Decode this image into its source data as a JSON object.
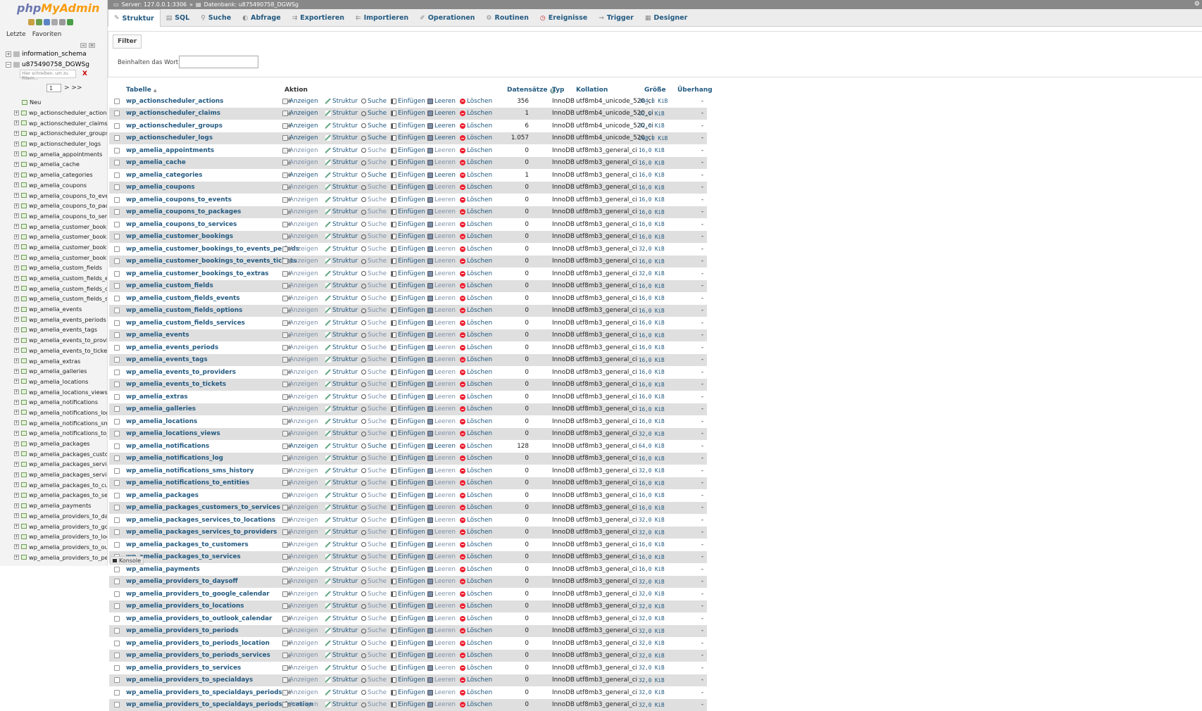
{
  "app": {
    "logo_php": "php",
    "logo_ma": "MyAdmin",
    "sidebar_tabs": [
      "Letzte",
      "Favoriten"
    ],
    "databases": [
      "information_schema",
      "u875490758_DGWSg"
    ],
    "filter_placeholder": "Hier schreiben, um zu filtern...",
    "filter_clear": "X",
    "page_select": "1",
    "page_next": "> >>",
    "tree_new": "Neu"
  },
  "breadcrumb": {
    "server": "Server: 127.0.0.1:3306",
    "sep": "»",
    "database": "Datenbank: u875490758_DGWSg"
  },
  "tabs": [
    "Struktur",
    "SQL",
    "Suche",
    "Abfrage",
    "Exportieren",
    "Importieren",
    "Operationen",
    "Routinen",
    "Ereignisse",
    "Trigger",
    "Designer"
  ],
  "filter": {
    "legend": "Filter",
    "label": "Beinhalten das Wort:",
    "value": ""
  },
  "columns": {
    "table": "Tabelle",
    "sort_arrow": "▲",
    "action": "Aktion",
    "rows": "Datensätze",
    "type": "Typ",
    "collation": "Kollation",
    "size": "Größe",
    "overhead": "Überhang"
  },
  "actions": {
    "browse": "Anzeigen",
    "structure": "Struktur",
    "search": "Suche",
    "insert": "Einfügen",
    "empty": "Leeren",
    "drop": "Löschen"
  },
  "console": "Konsole",
  "tree_items": [
    "wp_actionscheduler_actions",
    "wp_actionscheduler_claims",
    "wp_actionscheduler_groups",
    "wp_actionscheduler_logs",
    "wp_amelia_appointments",
    "wp_amelia_cache",
    "wp_amelia_categories",
    "wp_amelia_coupons",
    "wp_amelia_coupons_to_even",
    "wp_amelia_coupons_to_pack",
    "wp_amelia_coupons_to_servi",
    "wp_amelia_customer_bookin",
    "wp_amelia_customer_bookin",
    "wp_amelia_customer_bookin",
    "wp_amelia_customer_bookin",
    "wp_amelia_custom_fields",
    "wp_amelia_custom_fields_ev",
    "wp_amelia_custom_fields_op",
    "wp_amelia_custom_fields_se",
    "wp_amelia_events",
    "wp_amelia_events_periods",
    "wp_amelia_events_tags",
    "wp_amelia_events_to_provid",
    "wp_amelia_events_to_tickets",
    "wp_amelia_extras",
    "wp_amelia_galleries",
    "wp_amelia_locations",
    "wp_amelia_locations_views",
    "wp_amelia_notifications",
    "wp_amelia_notifications_log",
    "wp_amelia_notifications_sms",
    "wp_amelia_notifications_to_e",
    "wp_amelia_packages",
    "wp_amelia_packages_custom",
    "wp_amelia_packages_service",
    "wp_amelia_packages_service",
    "wp_amelia_packages_to_cus",
    "wp_amelia_packages_to_ser",
    "wp_amelia_payments",
    "wp_amelia_providers_to_day",
    "wp_amelia_providers_to_goo",
    "wp_amelia_providers_to_loca",
    "wp_amelia_providers_to_outl",
    "wp_amelia_providers_to_peri"
  ],
  "tables": [
    {
      "name": "wp_actionscheduler_actions",
      "rows": "356",
      "type": "InnoDB",
      "collation": "utf8mb4_unicode_520_ci",
      "size": "384,0 KiB",
      "overhead": "-"
    },
    {
      "name": "wp_actionscheduler_claims",
      "rows": "1",
      "type": "InnoDB",
      "collation": "utf8mb4_unicode_520_ci",
      "size": "32,0 KiB",
      "overhead": "-"
    },
    {
      "name": "wp_actionscheduler_groups",
      "rows": "6",
      "type": "InnoDB",
      "collation": "utf8mb4_unicode_520_ci",
      "size": "32,0 KiB",
      "overhead": "-"
    },
    {
      "name": "wp_actionscheduler_logs",
      "rows": "1.057",
      "type": "InnoDB",
      "collation": "utf8mb4_unicode_520_ci",
      "size": "208,0 KiB",
      "overhead": "-"
    },
    {
      "name": "wp_amelia_appointments",
      "rows": "0",
      "type": "InnoDB",
      "collation": "utf8mb3_general_ci",
      "size": "16,0 KiB",
      "overhead": "-"
    },
    {
      "name": "wp_amelia_cache",
      "rows": "0",
      "type": "InnoDB",
      "collation": "utf8mb3_general_ci",
      "size": "16,0 KiB",
      "overhead": "-"
    },
    {
      "name": "wp_amelia_categories",
      "rows": "1",
      "type": "InnoDB",
      "collation": "utf8mb3_general_ci",
      "size": "16,0 KiB",
      "overhead": "-"
    },
    {
      "name": "wp_amelia_coupons",
      "rows": "0",
      "type": "InnoDB",
      "collation": "utf8mb3_general_ci",
      "size": "16,0 KiB",
      "overhead": "-"
    },
    {
      "name": "wp_amelia_coupons_to_events",
      "rows": "0",
      "type": "InnoDB",
      "collation": "utf8mb3_general_ci",
      "size": "16,0 KiB",
      "overhead": "-"
    },
    {
      "name": "wp_amelia_coupons_to_packages",
      "rows": "0",
      "type": "InnoDB",
      "collation": "utf8mb3_general_ci",
      "size": "16,0 KiB",
      "overhead": "-"
    },
    {
      "name": "wp_amelia_coupons_to_services",
      "rows": "0",
      "type": "InnoDB",
      "collation": "utf8mb3_general_ci",
      "size": "16,0 KiB",
      "overhead": "-"
    },
    {
      "name": "wp_amelia_customer_bookings",
      "rows": "0",
      "type": "InnoDB",
      "collation": "utf8mb3_general_ci",
      "size": "16,0 KiB",
      "overhead": "-"
    },
    {
      "name": "wp_amelia_customer_bookings_to_events_periods",
      "rows": "0",
      "type": "InnoDB",
      "collation": "utf8mb3_general_ci",
      "size": "32,0 KiB",
      "overhead": "-"
    },
    {
      "name": "wp_amelia_customer_bookings_to_events_tickets",
      "rows": "0",
      "type": "InnoDB",
      "collation": "utf8mb3_general_ci",
      "size": "16,0 KiB",
      "overhead": "-"
    },
    {
      "name": "wp_amelia_customer_bookings_to_extras",
      "rows": "0",
      "type": "InnoDB",
      "collation": "utf8mb3_general_ci",
      "size": "32,0 KiB",
      "overhead": "-"
    },
    {
      "name": "wp_amelia_custom_fields",
      "rows": "0",
      "type": "InnoDB",
      "collation": "utf8mb3_general_ci",
      "size": "16,0 KiB",
      "overhead": "-"
    },
    {
      "name": "wp_amelia_custom_fields_events",
      "rows": "0",
      "type": "InnoDB",
      "collation": "utf8mb3_general_ci",
      "size": "16,0 KiB",
      "overhead": "-"
    },
    {
      "name": "wp_amelia_custom_fields_options",
      "rows": "0",
      "type": "InnoDB",
      "collation": "utf8mb3_general_ci",
      "size": "16,0 KiB",
      "overhead": "-"
    },
    {
      "name": "wp_amelia_custom_fields_services",
      "rows": "0",
      "type": "InnoDB",
      "collation": "utf8mb3_general_ci",
      "size": "16,0 KiB",
      "overhead": "-"
    },
    {
      "name": "wp_amelia_events",
      "rows": "0",
      "type": "InnoDB",
      "collation": "utf8mb3_general_ci",
      "size": "16,0 KiB",
      "overhead": "-"
    },
    {
      "name": "wp_amelia_events_periods",
      "rows": "0",
      "type": "InnoDB",
      "collation": "utf8mb3_general_ci",
      "size": "16,0 KiB",
      "overhead": "-"
    },
    {
      "name": "wp_amelia_events_tags",
      "rows": "0",
      "type": "InnoDB",
      "collation": "utf8mb3_general_ci",
      "size": "16,0 KiB",
      "overhead": "-"
    },
    {
      "name": "wp_amelia_events_to_providers",
      "rows": "0",
      "type": "InnoDB",
      "collation": "utf8mb3_general_ci",
      "size": "16,0 KiB",
      "overhead": "-"
    },
    {
      "name": "wp_amelia_events_to_tickets",
      "rows": "0",
      "type": "InnoDB",
      "collation": "utf8mb3_general_ci",
      "size": "16,0 KiB",
      "overhead": "-"
    },
    {
      "name": "wp_amelia_extras",
      "rows": "0",
      "type": "InnoDB",
      "collation": "utf8mb3_general_ci",
      "size": "16,0 KiB",
      "overhead": "-"
    },
    {
      "name": "wp_amelia_galleries",
      "rows": "0",
      "type": "InnoDB",
      "collation": "utf8mb3_general_ci",
      "size": "16,0 KiB",
      "overhead": "-"
    },
    {
      "name": "wp_amelia_locations",
      "rows": "0",
      "type": "InnoDB",
      "collation": "utf8mb3_general_ci",
      "size": "16,0 KiB",
      "overhead": "-"
    },
    {
      "name": "wp_amelia_locations_views",
      "rows": "0",
      "type": "InnoDB",
      "collation": "utf8mb3_general_ci",
      "size": "32,0 KiB",
      "overhead": "-"
    },
    {
      "name": "wp_amelia_notifications",
      "rows": "128",
      "type": "InnoDB",
      "collation": "utf8mb3_general_ci",
      "size": "64,0 KiB",
      "overhead": "-"
    },
    {
      "name": "wp_amelia_notifications_log",
      "rows": "0",
      "type": "InnoDB",
      "collation": "utf8mb3_general_ci",
      "size": "16,0 KiB",
      "overhead": "-"
    },
    {
      "name": "wp_amelia_notifications_sms_history",
      "rows": "0",
      "type": "InnoDB",
      "collation": "utf8mb3_general_ci",
      "size": "32,0 KiB",
      "overhead": "-"
    },
    {
      "name": "wp_amelia_notifications_to_entities",
      "rows": "0",
      "type": "InnoDB",
      "collation": "utf8mb3_general_ci",
      "size": "16,0 KiB",
      "overhead": "-"
    },
    {
      "name": "wp_amelia_packages",
      "rows": "0",
      "type": "InnoDB",
      "collation": "utf8mb3_general_ci",
      "size": "16,0 KiB",
      "overhead": "-"
    },
    {
      "name": "wp_amelia_packages_customers_to_services",
      "rows": "0",
      "type": "InnoDB",
      "collation": "utf8mb3_general_ci",
      "size": "16,0 KiB",
      "overhead": "-"
    },
    {
      "name": "wp_amelia_packages_services_to_locations",
      "rows": "0",
      "type": "InnoDB",
      "collation": "utf8mb3_general_ci",
      "size": "32,0 KiB",
      "overhead": "-"
    },
    {
      "name": "wp_amelia_packages_services_to_providers",
      "rows": "0",
      "type": "InnoDB",
      "collation": "utf8mb3_general_ci",
      "size": "32,0 KiB",
      "overhead": "-"
    },
    {
      "name": "wp_amelia_packages_to_customers",
      "rows": "0",
      "type": "InnoDB",
      "collation": "utf8mb3_general_ci",
      "size": "16,0 KiB",
      "overhead": "-"
    },
    {
      "name": "wp_amelia_packages_to_services",
      "rows": "0",
      "type": "InnoDB",
      "collation": "utf8mb3_general_ci",
      "size": "16,0 KiB",
      "overhead": "-"
    },
    {
      "name": "wp_amelia_payments",
      "rows": "0",
      "type": "InnoDB",
      "collation": "utf8mb3_general_ci",
      "size": "16,0 KiB",
      "overhead": "-"
    },
    {
      "name": "wp_amelia_providers_to_daysoff",
      "rows": "0",
      "type": "InnoDB",
      "collation": "utf8mb3_general_ci",
      "size": "32,0 KiB",
      "overhead": "-"
    },
    {
      "name": "wp_amelia_providers_to_google_calendar",
      "rows": "0",
      "type": "InnoDB",
      "collation": "utf8mb3_general_ci",
      "size": "32,0 KiB",
      "overhead": "-"
    },
    {
      "name": "wp_amelia_providers_to_locations",
      "rows": "0",
      "type": "InnoDB",
      "collation": "utf8mb3_general_ci",
      "size": "32,0 KiB",
      "overhead": "-"
    },
    {
      "name": "wp_amelia_providers_to_outlook_calendar",
      "rows": "0",
      "type": "InnoDB",
      "collation": "utf8mb3_general_ci",
      "size": "32,0 KiB",
      "overhead": "-"
    },
    {
      "name": "wp_amelia_providers_to_periods",
      "rows": "0",
      "type": "InnoDB",
      "collation": "utf8mb3_general_ci",
      "size": "32,0 KiB",
      "overhead": "-"
    },
    {
      "name": "wp_amelia_providers_to_periods_location",
      "rows": "0",
      "type": "InnoDB",
      "collation": "utf8mb3_general_ci",
      "size": "32,0 KiB",
      "overhead": "-"
    },
    {
      "name": "wp_amelia_providers_to_periods_services",
      "rows": "0",
      "type": "InnoDB",
      "collation": "utf8mb3_general_ci",
      "size": "32,0 KiB",
      "overhead": "-"
    },
    {
      "name": "wp_amelia_providers_to_services",
      "rows": "0",
      "type": "InnoDB",
      "collation": "utf8mb3_general_ci",
      "size": "32,0 KiB",
      "overhead": "-"
    },
    {
      "name": "wp_amelia_providers_to_specialdays",
      "rows": "0",
      "type": "InnoDB",
      "collation": "utf8mb3_general_ci",
      "size": "32,0 KiB",
      "overhead": "-"
    },
    {
      "name": "wp_amelia_providers_to_specialdays_periods",
      "rows": "0",
      "type": "InnoDB",
      "collation": "utf8mb3_general_ci",
      "size": "32,0 KiB",
      "overhead": "-"
    },
    {
      "name": "wp_amelia_providers_to_specialdays_periods_location",
      "rows": "0",
      "type": "InnoDB",
      "collation": "utf8mb3_general_ci",
      "size": "32,0 KiB",
      "overhead": "-"
    }
  ]
}
